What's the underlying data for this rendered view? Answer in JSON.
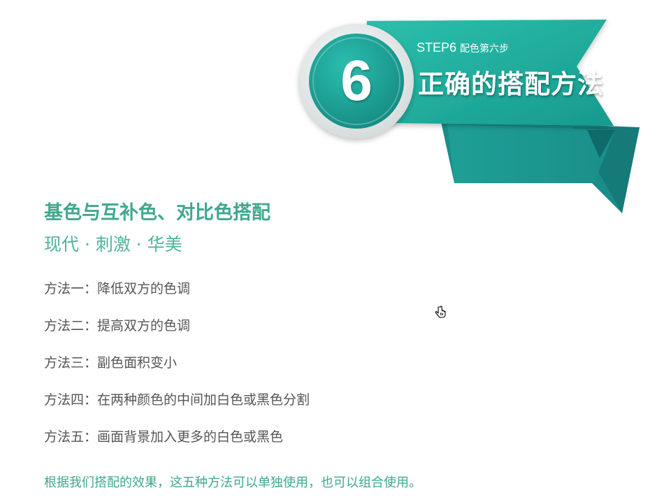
{
  "banner": {
    "step_label": "STEP6",
    "step_sub": "配色第六步",
    "title": "正确的搭配方法",
    "number": "6",
    "colors": {
      "ribbon_light": "#27b8a5",
      "ribbon_dark": "#168a85",
      "ribbon_shadow": "#0e6b6a",
      "badge_ring": "#e8ecec"
    }
  },
  "content": {
    "heading": "基色与互补色、对比色搭配",
    "subheading": "现代 · 刺激 · 华美",
    "methods": [
      "方法一：降低双方的色调",
      "方法二：提高双方的色调",
      "方法三：副色面积变小",
      "方法四：在两种颜色的中间加白色或黑色分割",
      "方法五：画面背景加入更多的白色或黑色"
    ],
    "footer": "根据我们搭配的效果，这五种方法可以单独使用，也可以组合使用。",
    "colors": {
      "heading": "#40a88f",
      "body": "#555555"
    }
  },
  "cursor": {
    "icon": "hand-pointer-icon"
  }
}
